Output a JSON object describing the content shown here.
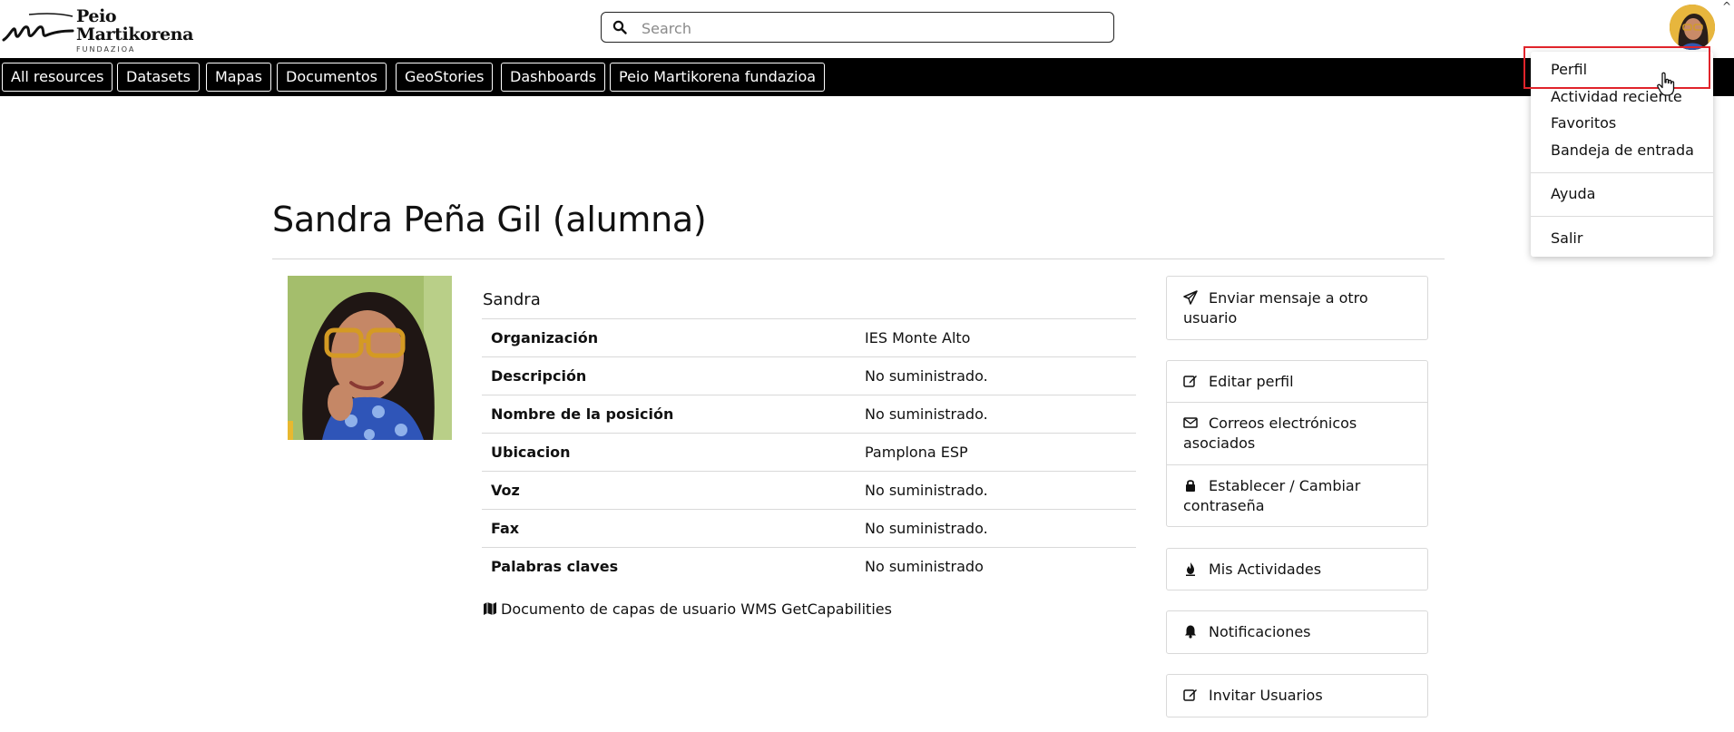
{
  "brand": {
    "name_line1": "Peio",
    "name_line2": "Martikorena",
    "subtitle": "FUNDAZIOA"
  },
  "search": {
    "placeholder": "Search",
    "value": ""
  },
  "nav": {
    "items": [
      {
        "label": "All resources"
      },
      {
        "label": "Datasets"
      },
      {
        "label": "Mapas"
      },
      {
        "label": "Documentos"
      },
      {
        "label": "GeoStories"
      },
      {
        "label": "Dashboards"
      },
      {
        "label": "Peio Martikorena fundazioa"
      }
    ]
  },
  "user_menu": {
    "items": [
      {
        "label": "Perfil"
      },
      {
        "label": "Actividad reciente"
      },
      {
        "label": "Favoritos"
      },
      {
        "label": "Bandeja de entrada"
      },
      {
        "label": "Ayuda"
      },
      {
        "label": "Salir"
      }
    ],
    "highlight_color": "#e0242b"
  },
  "profile": {
    "title": "Sandra Peña Gil (alumna)",
    "first_name": "Sandra",
    "fields": [
      {
        "key": "Organización",
        "value": "IES Monte Alto"
      },
      {
        "key": "Descripción",
        "value": "No suministrado."
      },
      {
        "key": "Nombre de la posición",
        "value": "No suministrado."
      },
      {
        "key": "Ubicacion",
        "value": "Pamplona ESP"
      },
      {
        "key": "Voz",
        "value": "No suministrado."
      },
      {
        "key": "Fax",
        "value": "No suministrado."
      },
      {
        "key": "Palabras claves",
        "value": "No suministrado"
      }
    ],
    "wms_link": "Documento de capas de usuario WMS GetCapabilities"
  },
  "actions": {
    "send_message": "Enviar mensaje a otro usuario",
    "edit_profile": "Editar perfil",
    "emails": "Correos electrónicos asociados",
    "password": "Establecer / Cambiar contraseña",
    "activities": "Mis Actividades",
    "notifications": "Notificaciones",
    "invite": "Invitar Usuarios"
  },
  "colors": {
    "navbar_bg": "#000000",
    "highlight": "#e0242b"
  }
}
